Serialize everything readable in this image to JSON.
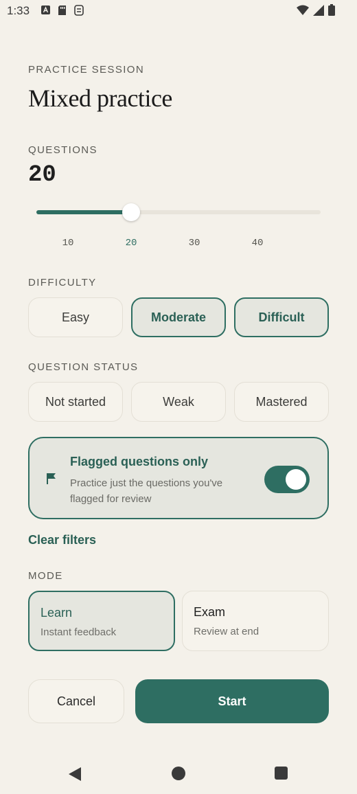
{
  "status_bar": {
    "time": "1:33"
  },
  "session": {
    "eyebrow": "PRACTICE SESSION",
    "title": "Mixed practice"
  },
  "questions": {
    "label": "QUESTIONS",
    "count": "20",
    "slider_value": 20,
    "slider_min": 5,
    "slider_max": 50,
    "ticks": [
      "10",
      "20",
      "30",
      "40"
    ]
  },
  "difficulty": {
    "label": "DIFFICULTY",
    "options": [
      {
        "label": "Easy",
        "selected": false
      },
      {
        "label": "Moderate",
        "selected": true
      },
      {
        "label": "Difficult",
        "selected": true
      }
    ]
  },
  "status": {
    "label": "QUESTION STATUS",
    "options": [
      {
        "label": "Not started",
        "selected": false
      },
      {
        "label": "Weak",
        "selected": false
      },
      {
        "label": "Mastered",
        "selected": false
      }
    ]
  },
  "flagged": {
    "title": "Flagged questions only",
    "subtitle": "Practice just the questions you've flagged for review",
    "enabled": true
  },
  "clear_filters": "Clear filters",
  "mode": {
    "label": "MODE",
    "options": [
      {
        "title": "Learn",
        "subtitle": "Instant feedback",
        "selected": true
      },
      {
        "title": "Exam",
        "subtitle": "Review at end",
        "selected": false
      }
    ]
  },
  "actions": {
    "cancel": "Cancel",
    "start": "Start"
  },
  "colors": {
    "accent": "#2e6e62",
    "background": "#f4f1ea",
    "selected_fill": "#e5e6df"
  }
}
